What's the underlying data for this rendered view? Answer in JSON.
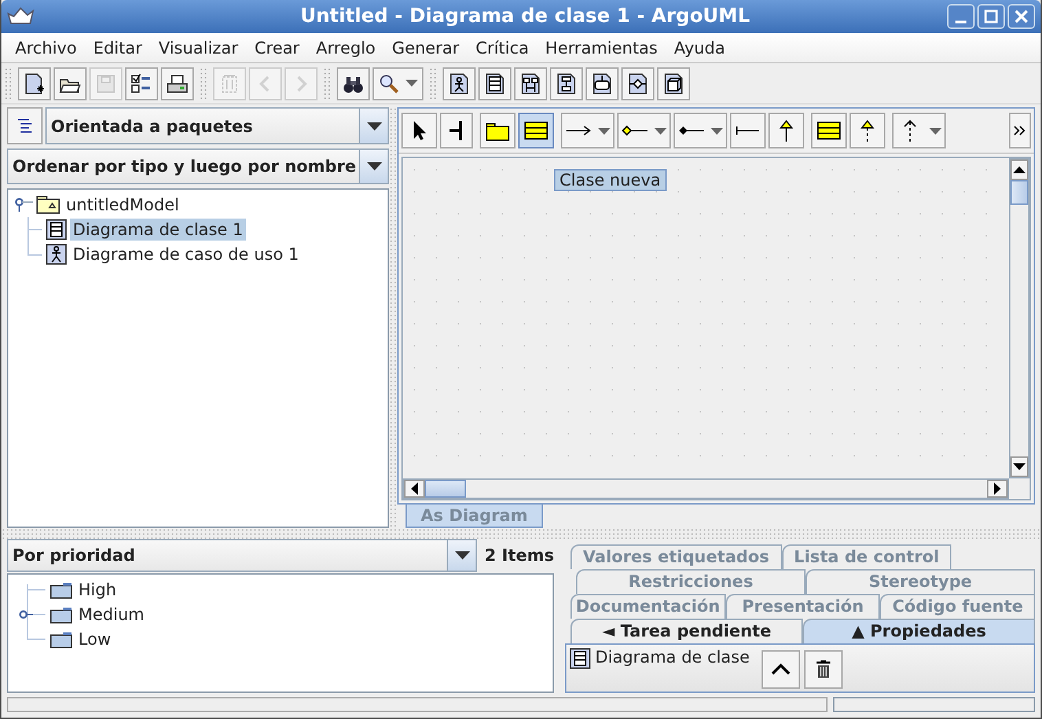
{
  "window": {
    "title": "Untitled - Diagrama de clase 1 - ArgoUML"
  },
  "menu": [
    "Archivo",
    "Editar",
    "Visualizar",
    "Crear",
    "Arreglo",
    "Generar",
    "Crítica",
    "Herramientas",
    "Ayuda"
  ],
  "toolbar_groups": [
    [
      {
        "kind": "new",
        "disabled": false
      },
      {
        "kind": "open",
        "disabled": false
      },
      {
        "kind": "save",
        "disabled": true
      },
      {
        "kind": "checklist",
        "disabled": false
      },
      {
        "kind": "print",
        "disabled": false
      }
    ],
    [
      {
        "kind": "delete",
        "disabled": true
      },
      {
        "kind": "back",
        "disabled": true
      },
      {
        "kind": "forward",
        "disabled": true
      }
    ],
    [
      {
        "kind": "find",
        "disabled": false
      },
      {
        "kind": "zoom",
        "disabled": false
      }
    ],
    [
      {
        "kind": "usecase",
        "disabled": false
      },
      {
        "kind": "class",
        "disabled": false
      },
      {
        "kind": "sequence",
        "disabled": false
      },
      {
        "kind": "collab",
        "disabled": false
      },
      {
        "kind": "state",
        "disabled": false
      },
      {
        "kind": "activity",
        "disabled": false
      },
      {
        "kind": "deploy",
        "disabled": false
      }
    ]
  ],
  "explorer": {
    "perspective": "Orientada a paquetes",
    "ordering": "Ordenar por tipo y luego por nombre",
    "tree": [
      {
        "label": "untitledModel",
        "kind": "package",
        "selected": false,
        "expanded": true,
        "children": [
          {
            "label": "Diagrama de clase 1",
            "kind": "class-diagram",
            "selected": true
          },
          {
            "label": "Diagrame de caso de uso 1",
            "kind": "usecase-diagram",
            "selected": false
          }
        ]
      }
    ]
  },
  "diagram": {
    "tool_groups": [
      [
        {
          "kind": "select",
          "selected": false
        },
        {
          "kind": "broom",
          "selected": false
        }
      ],
      [
        {
          "kind": "package",
          "selected": false
        },
        {
          "kind": "class",
          "selected": true
        }
      ],
      [
        {
          "kind": "association",
          "selected": false
        },
        {
          "kind": "aggregation",
          "selected": false
        },
        {
          "kind": "composition",
          "selected": false
        },
        {
          "kind": "assoc-end",
          "selected": false
        },
        {
          "kind": "generalization",
          "selected": false
        }
      ],
      [
        {
          "kind": "interface",
          "selected": false
        },
        {
          "kind": "realization",
          "selected": false
        }
      ],
      [
        {
          "kind": "dependency",
          "selected": false
        }
      ]
    ],
    "tooltip": "Clase nueva",
    "tab": "As Diagram"
  },
  "todo": {
    "grouping": "Por prioridad",
    "count": "2 Items",
    "items": [
      {
        "label": "High",
        "collapsed": false
      },
      {
        "label": "Medium",
        "collapsed": true
      },
      {
        "label": "Low",
        "collapsed": false
      }
    ]
  },
  "details": {
    "tab_rows": [
      [
        {
          "label": "Valores etiquetados",
          "selected": false
        },
        {
          "label": "Lista de control",
          "selected": false
        }
      ],
      [
        {
          "label": "Restricciones",
          "selected": false
        },
        {
          "label": "Stereotype",
          "selected": false
        }
      ],
      [
        {
          "label": "Documentación",
          "selected": false
        },
        {
          "label": "Presentación",
          "selected": false
        },
        {
          "label": "Código fuente",
          "selected": false
        }
      ],
      [
        {
          "label": "◄ Tarea pendiente",
          "selected": false
        },
        {
          "label": "▲ Propiedades",
          "selected": true
        }
      ]
    ],
    "target": "Diagrama de clase"
  }
}
